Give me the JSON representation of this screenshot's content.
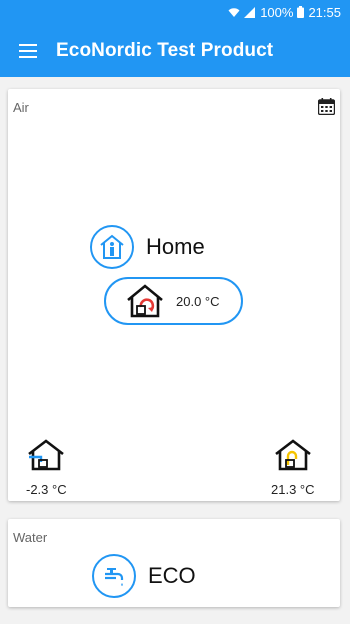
{
  "status_bar": {
    "battery": "100%",
    "time": "21:55"
  },
  "app_bar": {
    "title": "EcoNordic Test Product",
    "menu_icon": "menu-icon"
  },
  "air": {
    "label": "Air",
    "schedule_icon": "calendar-icon",
    "mode": "Home",
    "mode_icon": "person-home-icon",
    "setpoint": "20.0 °C",
    "setpoint_icon": "house-heating-icon",
    "outdoor_temp": "-2.3 °C",
    "outdoor_icon": "house-inflow-icon",
    "indoor_temp": "21.3 °C",
    "indoor_icon": "house-outflow-icon"
  },
  "water": {
    "label": "Water",
    "mode": "ECO",
    "mode_icon": "faucet-icon"
  },
  "colors": {
    "primary": "#2196f3",
    "heat": "#e53935",
    "cold": "#2196f3",
    "warm": "#f5c400"
  }
}
